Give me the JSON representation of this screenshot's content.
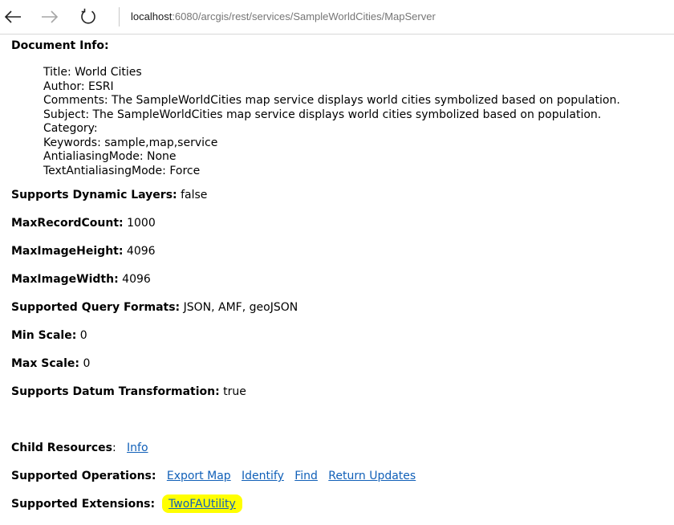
{
  "browser": {
    "url_host": "localhost",
    "url_rest": ":6080/arcgis/rest/services/SampleWorldCities/MapServer",
    "icons": [
      "back-arrow-icon",
      "forward-arrow-icon",
      "refresh-icon"
    ]
  },
  "doc_info": {
    "heading": "Document Info:",
    "lines": [
      "Title: World Cities",
      "Author: ESRI",
      "Comments: The SampleWorldCities map service displays world cities symbolized based on population.",
      "Subject: The SampleWorldCities map service displays world cities symbolized based on population.",
      "Category:",
      "Keywords: sample,map,service",
      "AntialiasingMode: None",
      "TextAntialiasingMode: Force"
    ]
  },
  "properties": [
    {
      "label": "Supports Dynamic Layers:",
      "value": "false"
    },
    {
      "label": "MaxRecordCount:",
      "value": "1000"
    },
    {
      "label": "MaxImageHeight:",
      "value": "4096"
    },
    {
      "label": "MaxImageWidth:",
      "value": "4096"
    },
    {
      "label": "Supported Query Formats:",
      "value": "JSON, AMF, geoJSON"
    },
    {
      "label": "Min Scale:",
      "value": "0"
    },
    {
      "label": "Max Scale:",
      "value": "0"
    },
    {
      "label": "Supports Datum Transformation:",
      "value": "true"
    }
  ],
  "child_resources": {
    "label": "Child Resources",
    "colon": ":",
    "links": [
      "Info"
    ]
  },
  "supported_operations": {
    "label": "Supported Operations:",
    "links": [
      "Export Map",
      "Identify",
      "Find",
      "Return Updates"
    ]
  },
  "supported_extensions": {
    "label": "Supported Extensions:",
    "links": [
      "TwoFAUtility"
    ],
    "highlight_color": "#ffff00"
  },
  "colors": {
    "link": "#1160b8",
    "highlight": "#ffff00"
  }
}
